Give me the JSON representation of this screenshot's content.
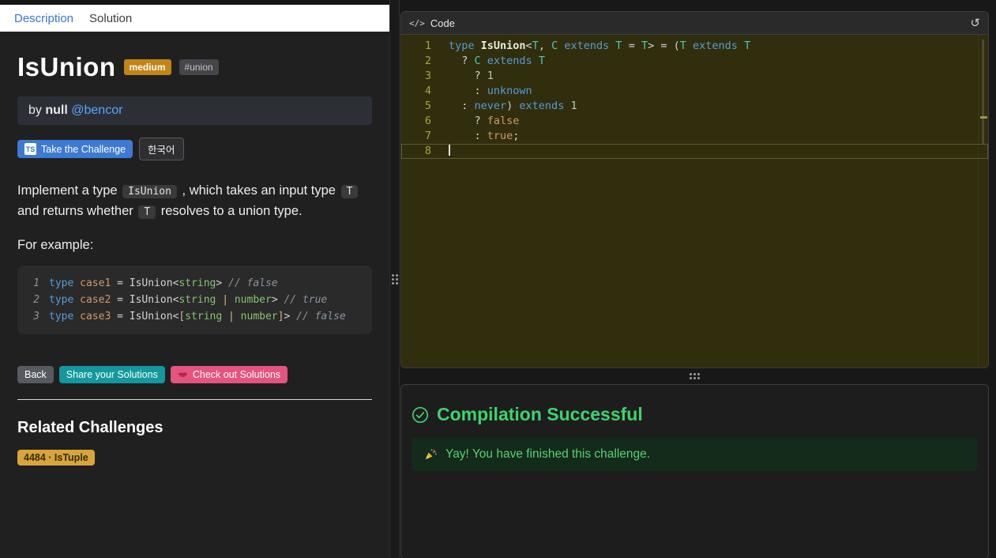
{
  "colors": {
    "accent_blue": "#3679d0",
    "link_blue": "#58a6ff",
    "button_blue": "#3e7ad3",
    "badge_amber": "#c28416",
    "related_amber": "#d9a53a",
    "teal": "#12989d",
    "pink": "#e5537f",
    "success_green": "#3dd36e"
  },
  "left": {
    "tabs": [
      {
        "label": "Description",
        "active": true
      },
      {
        "label": "Solution",
        "active": false
      }
    ],
    "title": "IsUnion",
    "difficulty_badge": "medium",
    "tag_badge": "#union",
    "author": {
      "prefix": "by",
      "name": "null",
      "handle": "@bencor"
    },
    "actions": {
      "ts_logo": "TS",
      "take_challenge": "Take the Challenge",
      "language": "한국어"
    },
    "description_segments": [
      {
        "t": "Implement a type ",
        "code": false
      },
      {
        "t": "IsUnion",
        "code": true
      },
      {
        "t": " , which takes an input type ",
        "code": false
      },
      {
        "t": "T",
        "code": true
      },
      {
        "t": " and returns whether ",
        "code": false
      },
      {
        "t": "T",
        "code": true
      },
      {
        "t": " resolves to a union type.",
        "code": false
      }
    ],
    "for_example": "For example:",
    "example_code": {
      "lines": [
        [
          {
            "t": "type ",
            "c": "kw"
          },
          {
            "t": "case1 ",
            "c": "var"
          },
          {
            "t": "= ",
            "c": "plain"
          },
          {
            "t": "IsUnion",
            "c": "plain"
          },
          {
            "t": "<",
            "c": "plain"
          },
          {
            "t": "string",
            "c": "tname"
          },
          {
            "t": ">",
            "c": "plain"
          },
          {
            "t": " ",
            "c": "plain"
          },
          {
            "t": "// false",
            "c": "cmt"
          }
        ],
        [
          {
            "t": "type ",
            "c": "kw"
          },
          {
            "t": "case2 ",
            "c": "var"
          },
          {
            "t": "= ",
            "c": "plain"
          },
          {
            "t": "IsUnion",
            "c": "plain"
          },
          {
            "t": "<",
            "c": "plain"
          },
          {
            "t": "string",
            "c": "tname"
          },
          {
            "t": " ",
            "c": "plain"
          },
          {
            "t": "|",
            "c": "punc"
          },
          {
            "t": " ",
            "c": "plain"
          },
          {
            "t": "number",
            "c": "tname"
          },
          {
            "t": ">",
            "c": "plain"
          },
          {
            "t": " ",
            "c": "plain"
          },
          {
            "t": "// true",
            "c": "cmt"
          }
        ],
        [
          {
            "t": "type ",
            "c": "kw"
          },
          {
            "t": "case3 ",
            "c": "var"
          },
          {
            "t": "= ",
            "c": "plain"
          },
          {
            "t": "IsUnion",
            "c": "plain"
          },
          {
            "t": "<",
            "c": "plain"
          },
          {
            "t": "[",
            "c": "punc"
          },
          {
            "t": "string",
            "c": "tname"
          },
          {
            "t": " ",
            "c": "plain"
          },
          {
            "t": "|",
            "c": "punc"
          },
          {
            "t": " ",
            "c": "plain"
          },
          {
            "t": "number",
            "c": "tname"
          },
          {
            "t": "]",
            "c": "punc"
          },
          {
            "t": ">",
            "c": "plain"
          },
          {
            "t": " ",
            "c": "plain"
          },
          {
            "t": "// false",
            "c": "cmt"
          }
        ]
      ]
    },
    "footer_buttons": {
      "back": "Back",
      "share": "Share your Solutions",
      "checkout": "Check out Solutions"
    },
    "related": {
      "heading": "Related Challenges",
      "items": [
        {
          "label": "4484 · IsTuple"
        }
      ]
    }
  },
  "editor": {
    "header_title": "Code",
    "code_icon": "</>",
    "reset_icon": "↺",
    "cursor_line": 8,
    "lines": [
      [
        {
          "t": "type ",
          "c": "kw"
        },
        {
          "t": "IsUnion",
          "c": "decl"
        },
        {
          "t": "<",
          "c": "plain"
        },
        {
          "t": "T",
          "c": "type"
        },
        {
          "t": ", ",
          "c": "plain"
        },
        {
          "t": "C",
          "c": "type"
        },
        {
          "t": " ",
          "c": "plain"
        },
        {
          "t": "extends",
          "c": "kw"
        },
        {
          "t": " ",
          "c": "plain"
        },
        {
          "t": "T",
          "c": "type"
        },
        {
          "t": " = ",
          "c": "plain"
        },
        {
          "t": "T",
          "c": "type"
        },
        {
          "t": "> = (",
          "c": "plain"
        },
        {
          "t": "T",
          "c": "type"
        },
        {
          "t": " ",
          "c": "plain"
        },
        {
          "t": "extends",
          "c": "kw"
        },
        {
          "t": " ",
          "c": "plain"
        },
        {
          "t": "T",
          "c": "type"
        }
      ],
      [
        {
          "t": "  ? ",
          "c": "plain"
        },
        {
          "t": "C",
          "c": "type"
        },
        {
          "t": " ",
          "c": "plain"
        },
        {
          "t": "extends",
          "c": "kw"
        },
        {
          "t": " ",
          "c": "plain"
        },
        {
          "t": "T",
          "c": "type"
        }
      ],
      [
        {
          "t": "    ? ",
          "c": "plain"
        },
        {
          "t": "1",
          "c": "num"
        }
      ],
      [
        {
          "t": "    : ",
          "c": "plain"
        },
        {
          "t": "unknown",
          "c": "kw"
        }
      ],
      [
        {
          "t": "  : ",
          "c": "plain"
        },
        {
          "t": "never",
          "c": "kw"
        },
        {
          "t": ") ",
          "c": "plain"
        },
        {
          "t": "extends",
          "c": "kw"
        },
        {
          "t": " ",
          "c": "plain"
        },
        {
          "t": "1",
          "c": "num"
        }
      ],
      [
        {
          "t": "    ? ",
          "c": "plain"
        },
        {
          "t": "false",
          "c": "bool"
        }
      ],
      [
        {
          "t": "    : ",
          "c": "plain"
        },
        {
          "t": "true",
          "c": "bool"
        },
        {
          "t": ";",
          "c": "plain"
        }
      ],
      []
    ]
  },
  "output": {
    "title": "Compilation Successful",
    "message": "Yay! You have finished this challenge."
  }
}
